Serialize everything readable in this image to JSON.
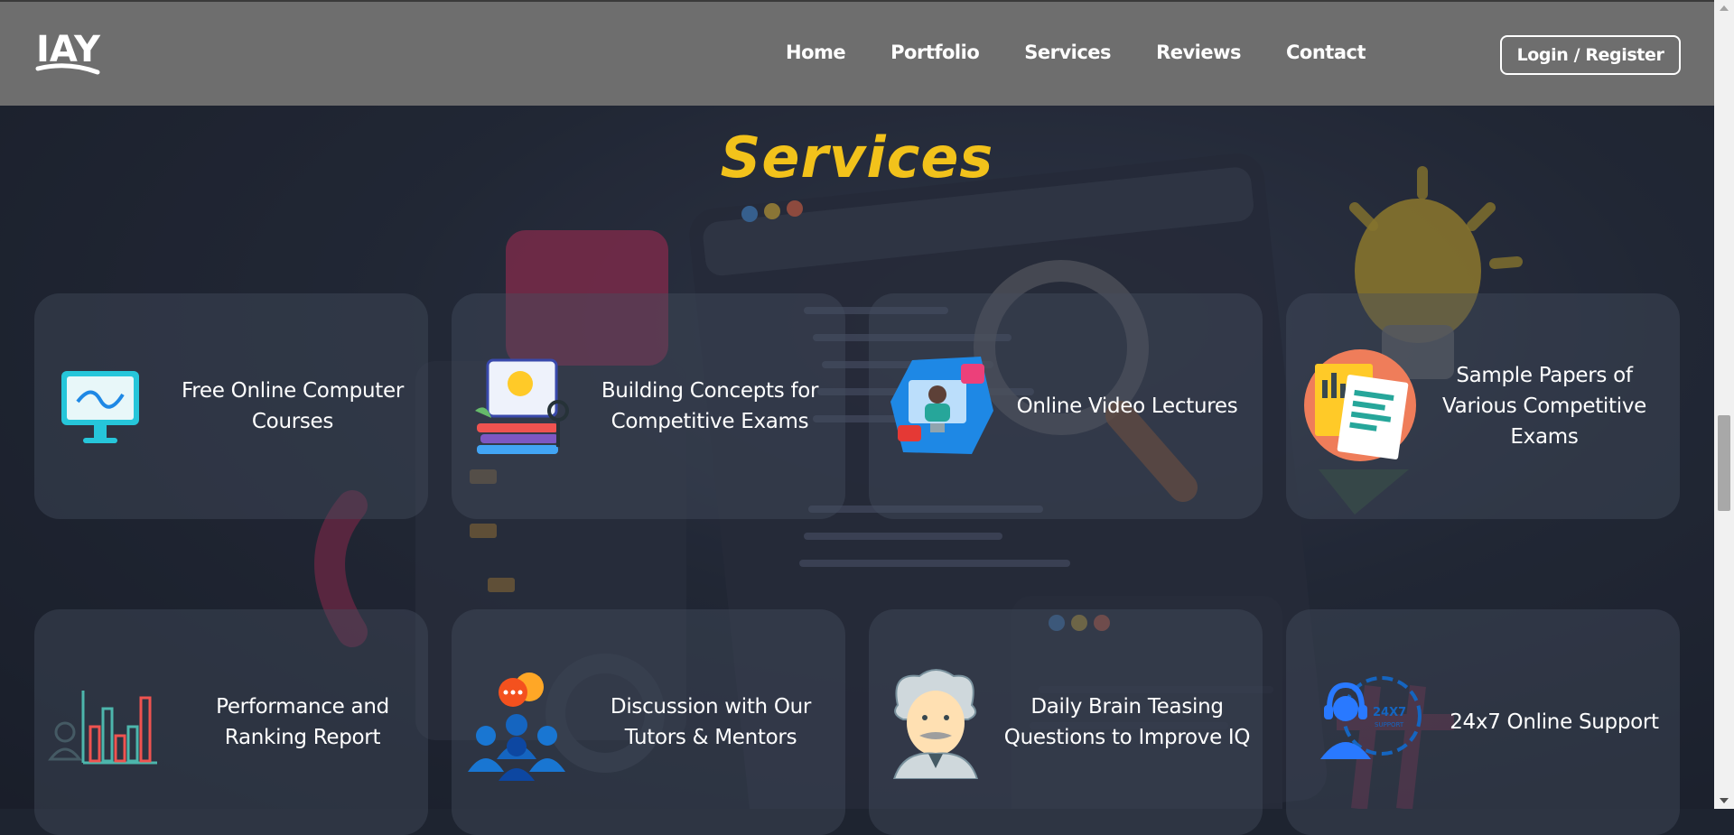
{
  "header": {
    "logo_text": "IAY",
    "nav": [
      "Home",
      "Portfolio",
      "Services",
      "Reviews",
      "Contact"
    ],
    "login_label": "Login / Register"
  },
  "section": {
    "title": "Services"
  },
  "services": [
    {
      "label": "Free Online Computer Courses",
      "icon": "computer-monitor-icon"
    },
    {
      "label": "Building Concepts for Competitive Exams",
      "icon": "study-concept-icon"
    },
    {
      "label": "Online Video Lectures",
      "icon": "video-lecture-icon"
    },
    {
      "label": "Sample Papers of Various Competitive Exams",
      "icon": "sample-papers-icon"
    },
    {
      "label": "Performance and Ranking Report",
      "icon": "bar-chart-icon"
    },
    {
      "label": "Discussion with Our Tutors & Mentors",
      "icon": "discussion-group-icon"
    },
    {
      "label": "Daily Brain Teasing Questions to Improve IQ",
      "icon": "einstein-icon"
    },
    {
      "label": "24x7 Online Support",
      "icon": "support-headset-icon"
    }
  ],
  "support_icon_text": "24X7",
  "support_icon_subtext": "SUPPORT",
  "colors": {
    "accent": "#f2c21b",
    "header_bg": "#6e6e6e",
    "card_bg": "rgba(70,78,95,0.42)"
  }
}
